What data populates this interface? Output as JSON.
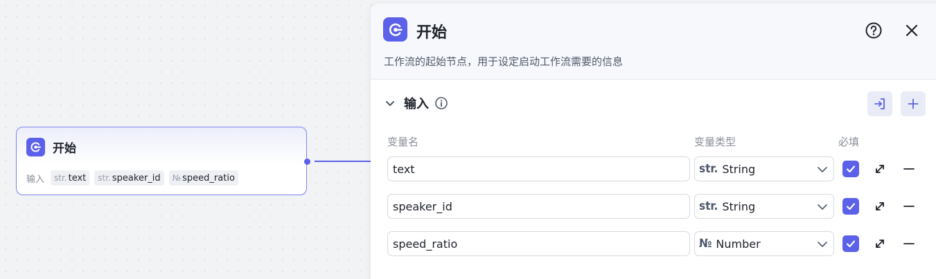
{
  "node": {
    "title": "开始",
    "inputs_label": "输入",
    "chips": [
      {
        "type": "str.",
        "name": "text"
      },
      {
        "type": "str.",
        "name": "speaker_id"
      },
      {
        "type": "№",
        "name": "speed_ratio"
      }
    ]
  },
  "panel": {
    "title": "开始",
    "description": "工作流的起始节点，用于设定启动工作流需要的信息",
    "section_title": "输入",
    "columns": {
      "name": "变量名",
      "type": "变量类型",
      "required": "必填"
    },
    "rows": [
      {
        "name": "text",
        "type_icon": "str.",
        "type": "String",
        "required": true
      },
      {
        "name": "speaker_id",
        "type_icon": "str.",
        "type": "String",
        "required": true
      },
      {
        "name": "speed_ratio",
        "type_icon": "№",
        "type": "Number",
        "required": true
      }
    ]
  },
  "icons": {
    "node": "start-node-icon",
    "help": "help-circle-icon",
    "close": "close-icon",
    "collapse": "chevron-down-icon",
    "info": "info-icon",
    "import": "import-icon",
    "add": "plus-icon",
    "expand": "expand-arrows-icon",
    "remove": "minus-icon",
    "check": "check-icon"
  },
  "colors": {
    "accent": "#5b61e8",
    "border": "#7b83f0"
  }
}
